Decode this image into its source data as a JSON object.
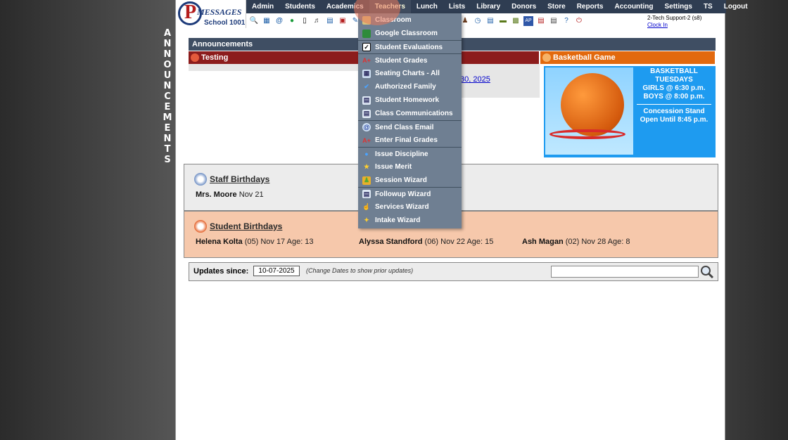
{
  "side_word": [
    "A",
    "N",
    "N",
    "O",
    "U",
    "N",
    "C",
    "E",
    "M",
    "E",
    "N",
    "T",
    "S"
  ],
  "logo": {
    "brand": "MESSAGES",
    "school": "School 1001"
  },
  "menu": [
    "Admin",
    "Students",
    "Academics",
    "Teachers",
    "Lunch",
    "Lists",
    "Library",
    "Donors",
    "Store",
    "Reports",
    "Accounting",
    "Settings",
    "TS",
    "Logout"
  ],
  "user": {
    "name": "2-Tech Support-2 (s8)",
    "clock_in": "Clock In"
  },
  "announcements": {
    "header": "Announcements",
    "testing_title": "Testing",
    "date_link": "30, 2025",
    "basketball_title": "Basketball Game",
    "bb_line1": "BASKETBALL",
    "bb_line2": "TUESDAYS",
    "bb_line3": "GIRLS @ 6:30 p.m.",
    "bb_line4": "BOYS @ 8:00 p.m.",
    "bb_line5": "Concession Stand",
    "bb_line6": "Open Until 8:45 p.m."
  },
  "staff_birthdays": {
    "title": "Staff Birthdays",
    "entries": [
      {
        "name": "Mrs. Moore",
        "detail": "Nov 21"
      }
    ]
  },
  "student_birthdays": {
    "title": "Student Birthdays",
    "entries": [
      {
        "name": "Helena Kolta",
        "detail": "(05) Nov 17 Age: 13"
      },
      {
        "name": "Alyssa Standford",
        "detail": "(06) Nov 22 Age: 15"
      },
      {
        "name": "Ash Magan",
        "detail": "(02) Nov 28 Age: 8"
      }
    ]
  },
  "updates": {
    "label": "Updates since:",
    "date": "10-07-2025",
    "hint": "(Change Dates to show prior updates)"
  },
  "dropdown": [
    "Classroom",
    "Google Classroom",
    "Student Evaluations",
    "Student Grades",
    "Seating Charts - All",
    "Authorized Family",
    "Student Homework",
    "Class Communications",
    "Send Class Email",
    "Enter Final Grades",
    "Issue Discipline",
    "Issue Merit",
    "Session Wizard",
    "Followup Wizard",
    "Services Wizard",
    "Intake Wizard"
  ]
}
